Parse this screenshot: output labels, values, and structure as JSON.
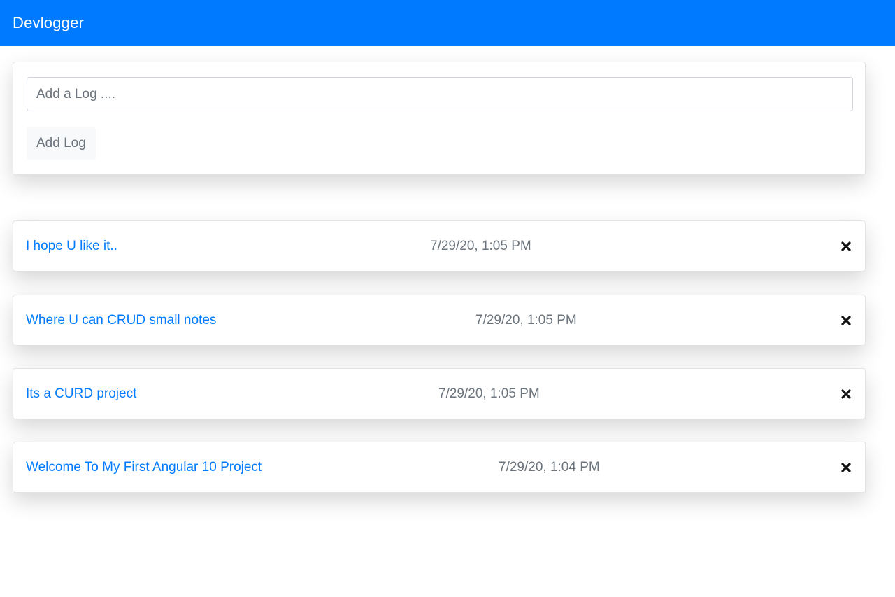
{
  "navbar": {
    "brand": "Devlogger",
    "color": "#007bff"
  },
  "form": {
    "input_placeholder": "Add a Log ....",
    "input_value": "",
    "button_label": "Add Log"
  },
  "logs": [
    {
      "text": "I hope U like it..",
      "date": "7/29/20, 1:05 PM"
    },
    {
      "text": "Where U can CRUD small notes",
      "date": "7/29/20, 1:05 PM"
    },
    {
      "text": "Its a CURD project",
      "date": "7/29/20, 1:05 PM"
    },
    {
      "text": "Welcome To My First Angular 10 Project",
      "date": "7/29/20, 1:04 PM"
    }
  ],
  "icons": {
    "delete": "close-icon"
  },
  "colors": {
    "link": "#007bff",
    "muted": "#6c757d"
  }
}
